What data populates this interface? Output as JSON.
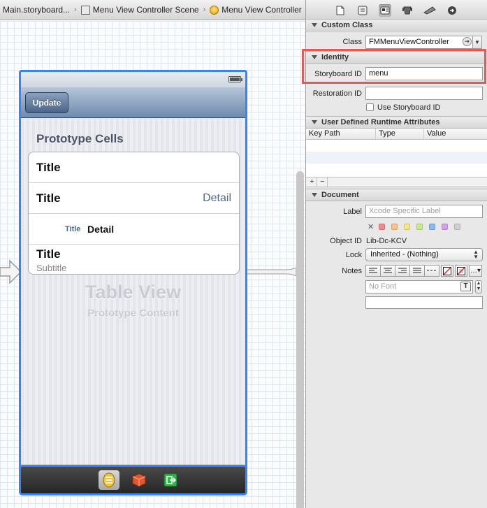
{
  "jumpbar": {
    "crumbs": [
      "Main.storyboard...",
      "Menu View Controller Scene",
      "Menu View Controller"
    ]
  },
  "canvas": {
    "nav_button": "Update",
    "section_header": "Prototype Cells",
    "cells": [
      {
        "title": "Title"
      },
      {
        "title": "Title",
        "detail": "Detail"
      },
      {
        "title": "Title",
        "detail": "Detail"
      },
      {
        "title": "Title",
        "subtitle": "Subtitle"
      }
    ],
    "table_view_label": "Table View",
    "table_view_sublabel": "Prototype Content"
  },
  "inspector": {
    "custom_class": {
      "header": "Custom Class",
      "class_label": "Class",
      "class_value": "FMMenuViewController"
    },
    "identity": {
      "header": "Identity",
      "storyboard_id_label": "Storyboard ID",
      "storyboard_id_value": "menu",
      "restoration_id_label": "Restoration ID",
      "restoration_id_value": "",
      "use_storyboard_id_label": "Use Storyboard ID"
    },
    "runtime_attributes": {
      "header": "User Defined Runtime Attributes",
      "columns": [
        "Key Path",
        "Type",
        "Value"
      ],
      "add": "+",
      "remove": "−"
    },
    "document": {
      "header": "Document",
      "label_label": "Label",
      "label_placeholder": "Xcode Specific Label",
      "clear_mark": "✕",
      "swatches": [
        "#f08a8a",
        "#f5c28a",
        "#f3e58a",
        "#c8e88a",
        "#8ab8f0",
        "#d2a2e6",
        "#cfcfcf"
      ],
      "object_id_label": "Object ID",
      "object_id_value": "Lib-Dc-KCV",
      "lock_label": "Lock",
      "lock_value": "Inherited - (Nothing)",
      "notes_label": "Notes",
      "font_placeholder": "No Font"
    }
  }
}
